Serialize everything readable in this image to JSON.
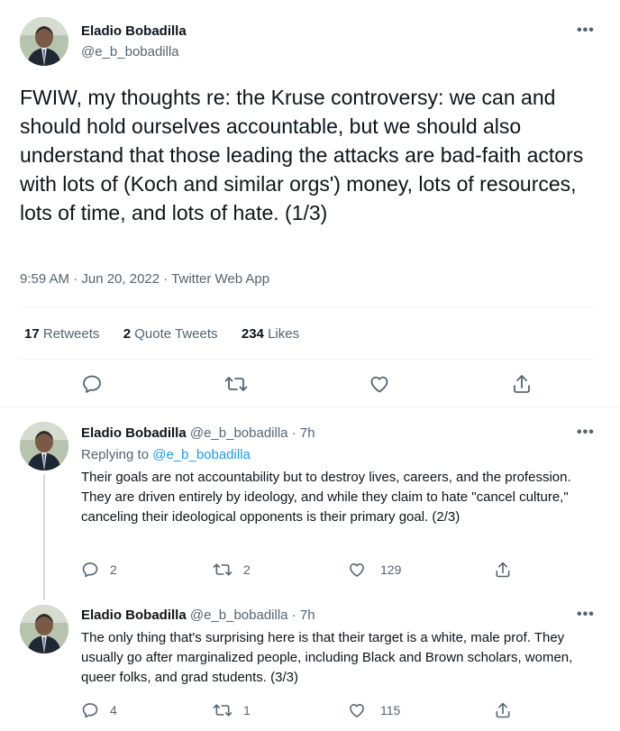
{
  "main_tweet": {
    "author_name": "Eladio Bobadilla",
    "author_handle": "@e_b_bobadilla",
    "more_label": "•••",
    "text": "FWIW, my thoughts re: the Kruse controversy: we can and should hold ourselves accountable, but we should also understand that those leading the attacks are bad-faith actors with lots of (Koch and similar orgs') money, lots of resources, lots of time, and lots of hate. (1/3)",
    "timestamp": "9:59 AM · Jun 20, 2022 · Twitter Web App",
    "retweets_count": "17",
    "retweets_label": "Retweets",
    "quotes_count": "2",
    "quotes_label": "Quote Tweets",
    "likes_count": "234",
    "likes_label": "Likes"
  },
  "replies": [
    {
      "author_name": "Eladio Bobadilla",
      "author_handle": "@e_b_bobadilla",
      "time": "· 7h",
      "replying_prefix": "Replying to",
      "replying_handle": "@e_b_bobadilla",
      "more_label": "•••",
      "text": "Their goals are not accountability but to destroy lives, careers, and the profession. They are driven entirely by ideology, and while they claim to hate \"cancel culture,\" canceling their ideological opponents is their primary goal. (2/3)",
      "reply_count": "2",
      "retweet_count": "2",
      "like_count": "129"
    },
    {
      "author_name": "Eladio Bobadilla",
      "author_handle": "@e_b_bobadilla",
      "time": "· 7h",
      "more_label": "•••",
      "text": "The only thing that's surprising here is that their target is a white, male prof. They usually go after marginalized people, including Black and Brown scholars, women, queer folks, and grad students. (3/3)",
      "reply_count": "4",
      "retweet_count": "1",
      "like_count": "115"
    }
  ],
  "colors": {
    "text": "#0f1419",
    "secondary": "#536471",
    "link": "#1d9bf0",
    "divider": "#eff3f4"
  },
  "icons": [
    "reply-icon",
    "retweet-icon",
    "like-icon",
    "share-icon",
    "more-icon"
  ]
}
